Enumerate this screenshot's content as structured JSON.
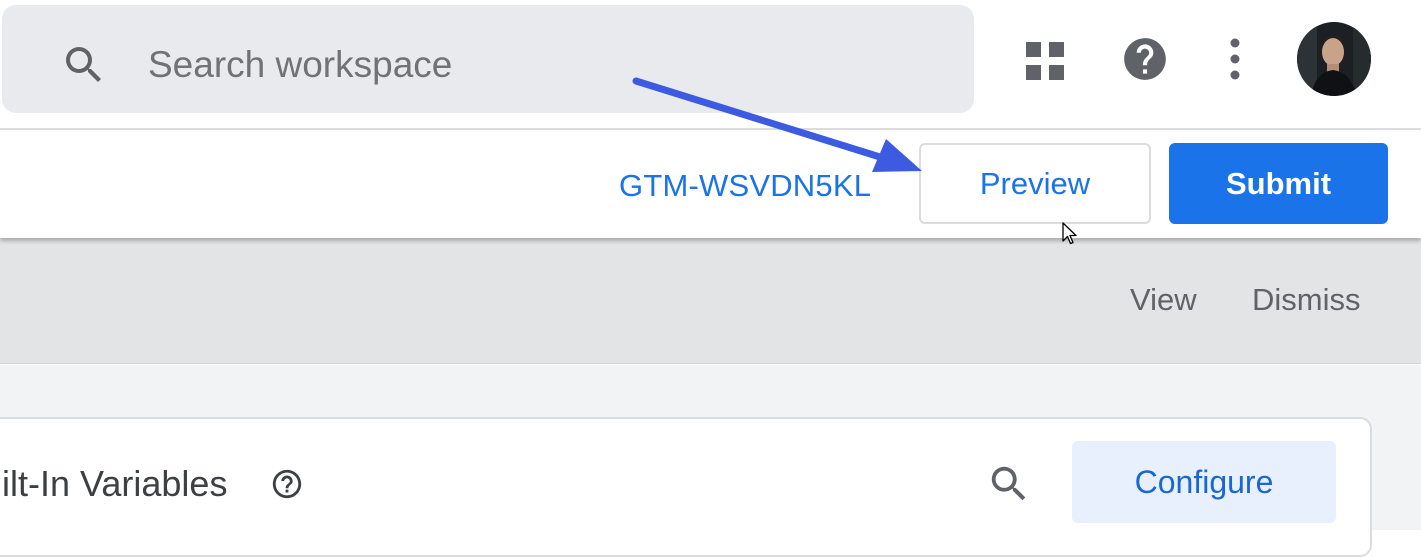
{
  "header": {
    "search": {
      "placeholder": "Search workspace",
      "value": ""
    },
    "icons": {
      "search": "search-icon",
      "apps": "apps-grid-icon",
      "help": "help-icon",
      "more": "more-vert-icon",
      "avatar": "user-avatar"
    }
  },
  "toolbar": {
    "container_id": "GTM-WSVDN5KL",
    "preview_label": "Preview",
    "submit_label": "Submit"
  },
  "banner": {
    "view_label": "View",
    "dismiss_label": "Dismiss"
  },
  "builtin_variables": {
    "title": "uilt-In Variables",
    "configure_label": "Configure",
    "icons": {
      "help": "help-outline-icon",
      "search": "search-icon"
    }
  },
  "colors": {
    "accent": "#1a73e8",
    "accent_dark": "#1967d2",
    "search_bg": "#e9eaed",
    "banner_bg": "#e3e4e6",
    "content_bg": "#f1f3f4",
    "configure_bg": "#e8f0fe",
    "icon_gray": "#5f6368",
    "annotation_arrow": "#3d5be0"
  }
}
